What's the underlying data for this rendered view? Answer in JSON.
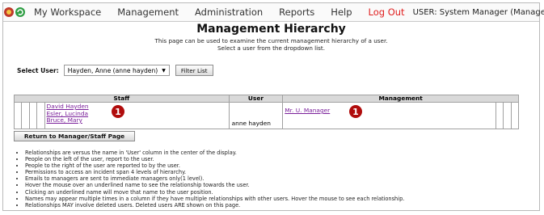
{
  "nav": {
    "items": [
      "My Workspace",
      "Management",
      "Administration",
      "Reports",
      "Help",
      "Log Out"
    ],
    "user_label": "USER: System Manager (Manager)",
    "logout_color": "#e02020"
  },
  "page": {
    "title": "Management Hierarchy",
    "desc_line1": "This page can be used to examine the current management hierarchy of a user.",
    "desc_line2": "Select a user from the dropdown list."
  },
  "select": {
    "label": "Select User:",
    "value": "Hayden, Anne (anne hayden)",
    "filter_button": "Filter List"
  },
  "table": {
    "headers": {
      "staff": "Staff",
      "user": "User",
      "management": "Management"
    },
    "staff": [
      "David Hayden",
      "Esler, Lucinda",
      "Bruce, Mary"
    ],
    "user": "anne hayden",
    "management": [
      "Mr. U. Manager"
    ],
    "badges": [
      "1",
      "1"
    ]
  },
  "return_button": "Return to Manager/Staff Page",
  "notes": [
    "Relationships are versus the name in 'User' column in the center of the display.",
    "People on the left of the user, report to the user.",
    "People to the right of the user are reported to by the user.",
    "Permissions to access an incident span 4 levels of hierarchy.",
    "Emails to managers are sent to immediate managers only(1 level).",
    "Hover the mouse over an underlined name to see the relationship towards the user.",
    "Clicking an underlined name will move that name to the user position.",
    "Names may appear multiple times in a column if they have multiple relationships with other users. Hover the mouse to see each relationship.",
    "Relationships MAY involve deleted users. Deleted users ARE shown on this page."
  ],
  "colors": {
    "badge": "#b00c0c",
    "link": "#7a1f9a",
    "header_bg": "#d9d9d9"
  }
}
